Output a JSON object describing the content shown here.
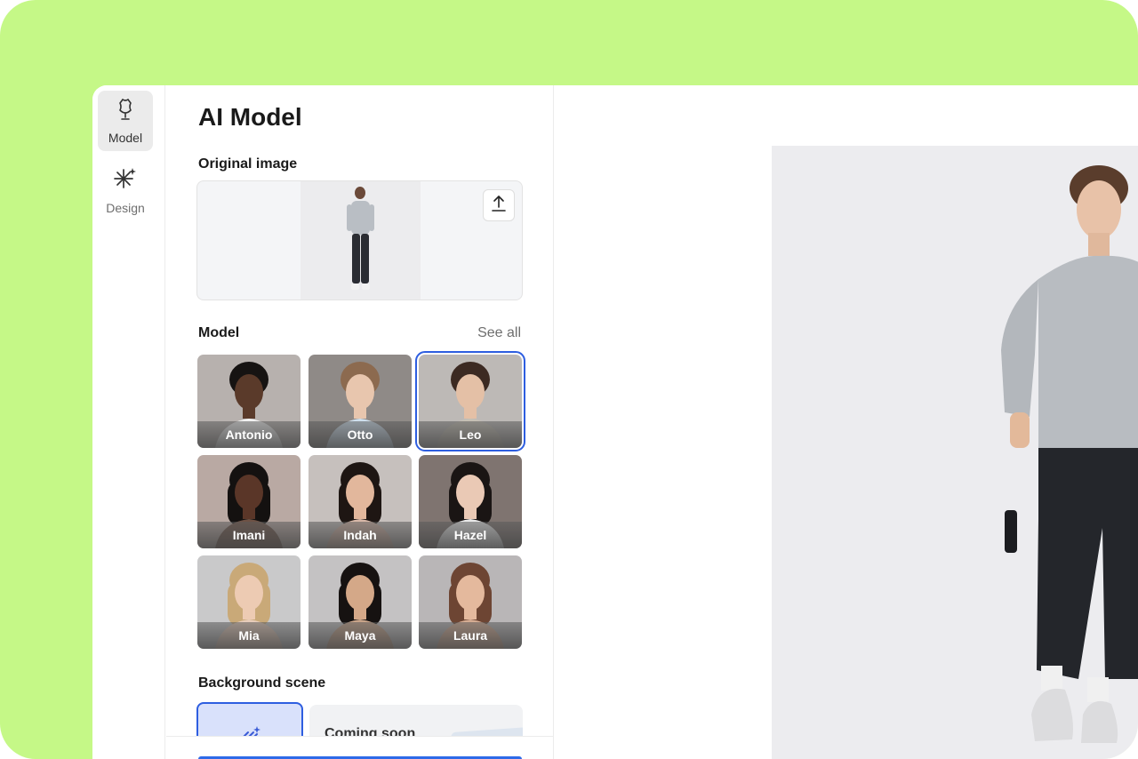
{
  "sidebar": {
    "items": [
      {
        "label": "Model",
        "icon": "dress-form-icon",
        "active": true
      },
      {
        "label": "Design",
        "icon": "sparkle-wand-icon",
        "active": false
      }
    ]
  },
  "panel": {
    "title": "AI Model",
    "original_image": {
      "heading": "Original image",
      "upload_icon": "upload-icon"
    },
    "model": {
      "heading": "Model",
      "see_all": "See all",
      "selected": "Leo",
      "items": [
        "Antonio",
        "Otto",
        "Leo",
        "Imani",
        "Indah",
        "Hazel",
        "Mia",
        "Maya",
        "Laura"
      ]
    },
    "background": {
      "heading": "Background scene",
      "coming_soon": "Coming soon"
    }
  },
  "colors": {
    "frame": "#c5f887",
    "accent": "#2e5ee0",
    "preview_bg": "#ececef"
  }
}
